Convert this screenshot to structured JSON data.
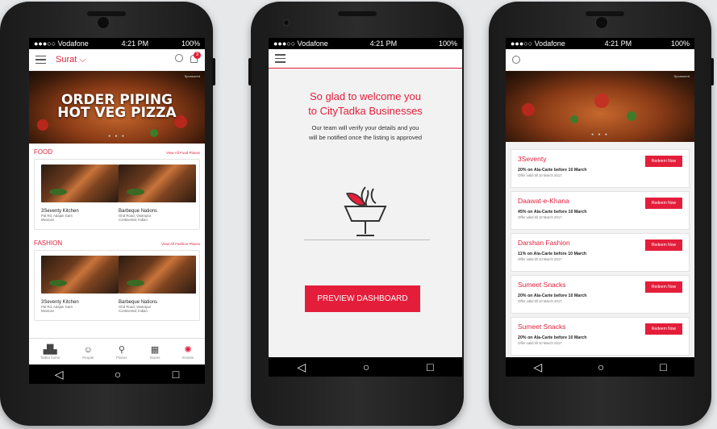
{
  "status": {
    "carrier": "●●●○○ Vodafone",
    "time": "4:21 PM",
    "battery": "100%"
  },
  "screen1": {
    "city": "Surat",
    "notif_count": "3",
    "banner": {
      "text_line1": "ORDER PIPING",
      "text_line2": "HOT VEG PIZZA",
      "sponsored": "Sponsored"
    },
    "sections": [
      {
        "title": "FOOD",
        "link": "View All Food Places",
        "places": [
          {
            "name": "3Seventy Kitchen",
            "desc1": "Pal Rd, Adajan Gam",
            "desc2": "Mexican"
          },
          {
            "name": "Barbeque Nations",
            "desc1": "Ghd Road, Vastrapur",
            "desc2": "Continental, Indian"
          }
        ]
      },
      {
        "title": "FASHION",
        "link": "View All Fashion Places",
        "places": [
          {
            "name": "3Seventy Kitchen",
            "desc1": "Pal Rd, Adajan Gam",
            "desc2": "Mexican"
          },
          {
            "name": "Barbeque Nations",
            "desc1": "Ghd Road, Vastrapur",
            "desc2": "Continental, Indian"
          }
        ]
      }
    ],
    "tabs": [
      {
        "label": "Tadka home",
        "icon": "city-icon"
      },
      {
        "label": "People",
        "icon": "people-icon"
      },
      {
        "label": "Places",
        "icon": "pin-icon"
      },
      {
        "label": "Stores",
        "icon": "store-icon"
      },
      {
        "label": "Events",
        "icon": "events-icon"
      }
    ]
  },
  "screen2": {
    "welcome_line1": "So glad to welcome you",
    "welcome_line2": "to CityTadka Businesses",
    "sub_line1": "Our team will verify your details and you",
    "sub_line2": "will be notified once the listing is approved",
    "cta": "PREVIEW DASHBOARD"
  },
  "screen3": {
    "sponsored": "Sponsored",
    "redeem_label": "Redeem Now",
    "offers": [
      {
        "name": "3Seventy",
        "deal": "20% on Ala-Carte before 10 March",
        "valid": "Offer valid till 10 March 2017"
      },
      {
        "name": "Daawat-e-Khana",
        "deal": "45% on Ala-Carte before 10 March",
        "valid": "Offer valid till 10 March 2017"
      },
      {
        "name": "Darshan Fashion",
        "deal": "11% on Ala-Carte before 10 March",
        "valid": "Offer valid till 10 March 2017"
      },
      {
        "name": "Sumeet Snacks",
        "deal": "20% on Ala-Carte before 10 March",
        "valid": "Offer valid till 10 March 2017"
      },
      {
        "name": "Sumeet Snacks",
        "deal": "20% on Ala-Carte before 10 March",
        "valid": "Offer valid till 10 March 2017"
      }
    ]
  },
  "nav": {
    "back": "◁",
    "home": "○",
    "recent": "□"
  },
  "colors": {
    "accent": "#e41e3a"
  }
}
